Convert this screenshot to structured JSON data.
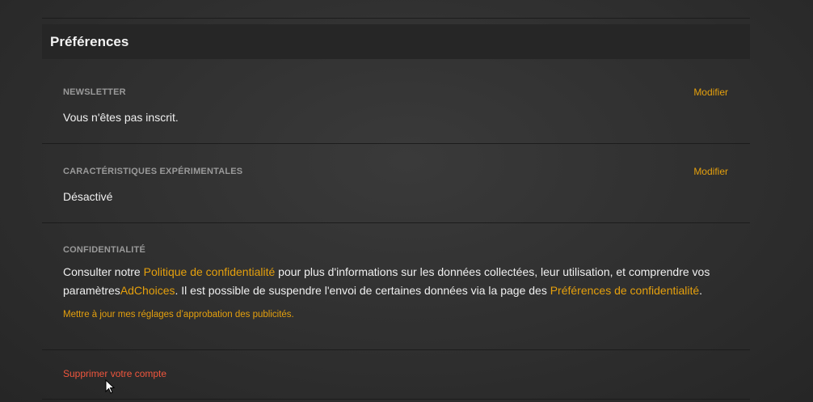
{
  "panel": {
    "title": "Préférences"
  },
  "newsletter": {
    "label": "NEWSLETTER",
    "value": "Vous n'êtes pas inscrit.",
    "modify_label": "Modifier"
  },
  "experimental": {
    "label": "CARACTÉRISTIQUES EXPÉRIMENTALES",
    "value": "Désactivé",
    "modify_label": "Modifier"
  },
  "privacy": {
    "label": "CONFIDENTIALITÉ",
    "text_1": "Consulter notre ",
    "policy_link": "Politique de confidentialité",
    "text_2": " pour plus d'informations sur les données collectées, leur utilisation, et comprendre vos paramètres",
    "adchoices_link": "AdChoices",
    "text_3": ". Il est possible de suspendre l'envoi de certaines données via la page des ",
    "prefs_link": "Préférences de confidentialité",
    "text_4": ".",
    "ad_settings_link": "Mettre à jour mes réglages d’approbation des publicités."
  },
  "account": {
    "delete_label": "Supprimer votre compte"
  },
  "colors": {
    "accent": "#e5a00d",
    "danger": "#f0563d",
    "background": "#2f2f2f",
    "header_background": "#262626"
  }
}
